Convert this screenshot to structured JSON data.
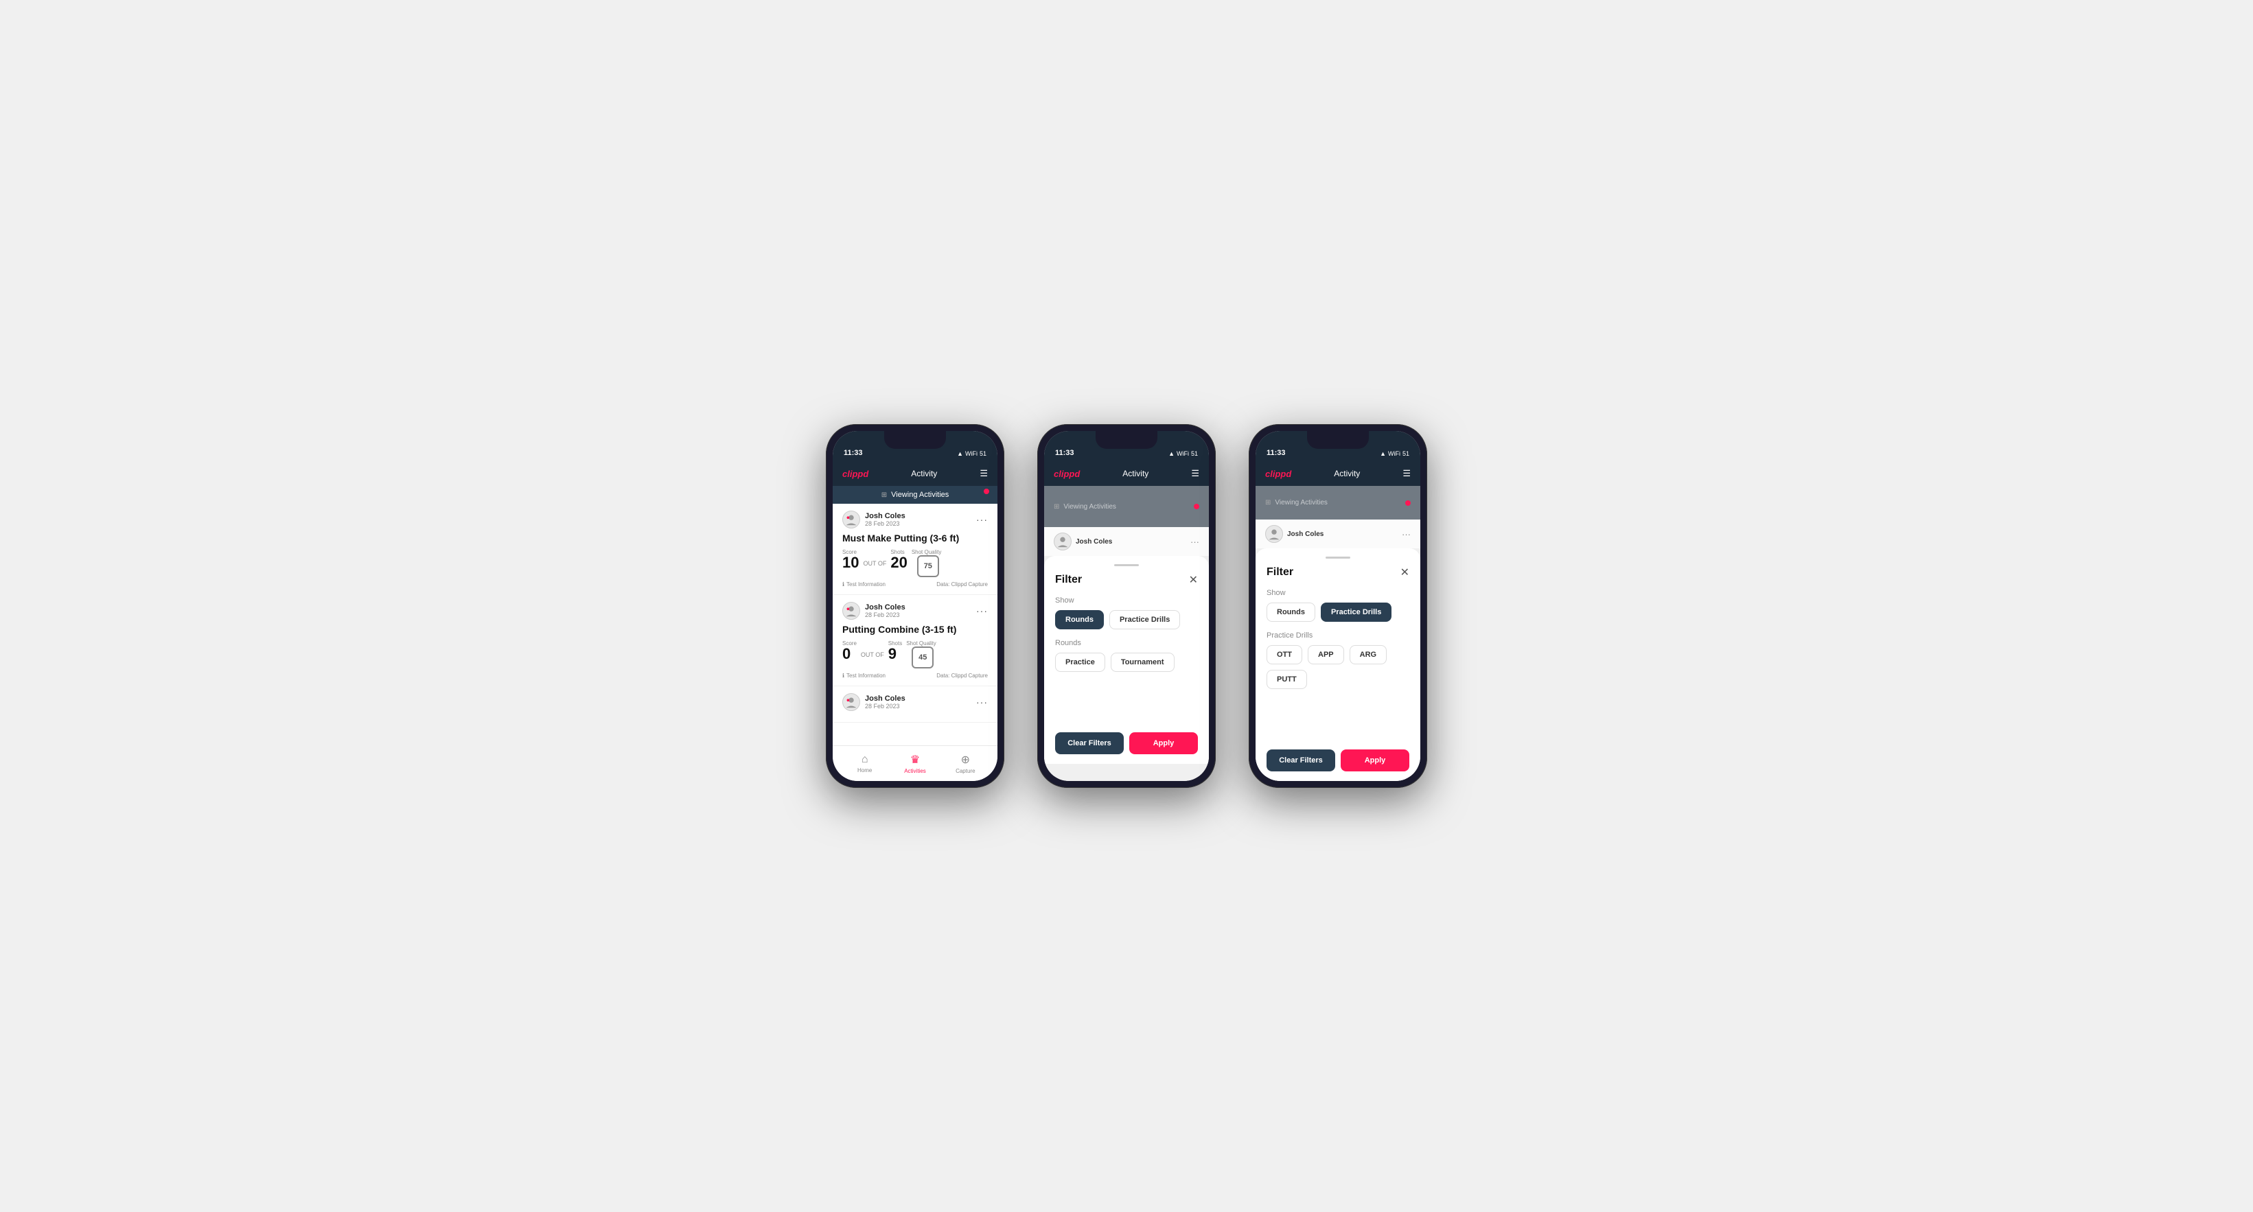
{
  "phones": [
    {
      "id": "phone1",
      "statusBar": {
        "time": "11:33",
        "icons": "▲ WiFi 51"
      },
      "header": {
        "logo": "clippd",
        "title": "Activity",
        "menuIcon": "☰"
      },
      "viewingBanner": {
        "text": "Viewing Activities",
        "showDot": true
      },
      "activities": [
        {
          "userName": "Josh Coles",
          "date": "28 Feb 2023",
          "title": "Must Make Putting (3-6 ft)",
          "score": "10",
          "outOf": "OUT OF",
          "shots": "20",
          "shotQualityLabel": "Shot Quality",
          "shotQuality": "75",
          "info": "Test Information",
          "dataSource": "Data: Clippd Capture"
        },
        {
          "userName": "Josh Coles",
          "date": "28 Feb 2023",
          "title": "Putting Combine (3-15 ft)",
          "score": "0",
          "outOf": "OUT OF",
          "shots": "9",
          "shotQualityLabel": "Shot Quality",
          "shotQuality": "45",
          "info": "Test Information",
          "dataSource": "Data: Clippd Capture"
        },
        {
          "userName": "Josh Coles",
          "date": "28 Feb 2023",
          "title": "",
          "score": "",
          "outOf": "",
          "shots": "",
          "shotQualityLabel": "",
          "shotQuality": "",
          "info": "",
          "dataSource": ""
        }
      ],
      "nav": {
        "items": [
          {
            "icon": "⌂",
            "label": "Home",
            "active": false
          },
          {
            "icon": "♛",
            "label": "Activities",
            "active": true
          },
          {
            "icon": "⊕",
            "label": "Capture",
            "active": false
          }
        ]
      }
    },
    {
      "id": "phone2",
      "statusBar": {
        "time": "11:33",
        "icons": "▲ WiFi 51"
      },
      "header": {
        "logo": "clippd",
        "title": "Activity",
        "menuIcon": "☰"
      },
      "viewingBanner": {
        "text": "Viewing Activities",
        "showDot": true
      },
      "filter": {
        "title": "Filter",
        "showLabel": "Show",
        "showButtons": [
          {
            "label": "Rounds",
            "active": true
          },
          {
            "label": "Practice Drills",
            "active": false
          }
        ],
        "roundsLabel": "Rounds",
        "roundButtons": [
          {
            "label": "Practice",
            "active": false
          },
          {
            "label": "Tournament",
            "active": false
          }
        ],
        "clearFiltersLabel": "Clear Filters",
        "applyLabel": "Apply"
      }
    },
    {
      "id": "phone3",
      "statusBar": {
        "time": "11:33",
        "icons": "▲ WiFi 51"
      },
      "header": {
        "logo": "clippd",
        "title": "Activity",
        "menuIcon": "☰"
      },
      "viewingBanner": {
        "text": "Viewing Activities",
        "showDot": true
      },
      "filter": {
        "title": "Filter",
        "showLabel": "Show",
        "showButtons": [
          {
            "label": "Rounds",
            "active": false
          },
          {
            "label": "Practice Drills",
            "active": true
          }
        ],
        "drillsLabel": "Practice Drills",
        "drillButtons": [
          {
            "label": "OTT",
            "active": false
          },
          {
            "label": "APP",
            "active": false
          },
          {
            "label": "ARG",
            "active": false
          },
          {
            "label": "PUTT",
            "active": false
          }
        ],
        "clearFiltersLabel": "Clear Filters",
        "applyLabel": "Apply"
      }
    }
  ]
}
